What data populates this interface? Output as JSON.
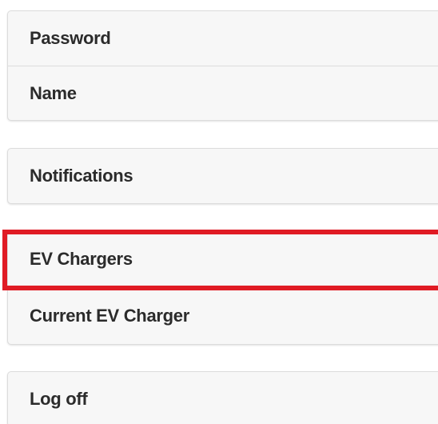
{
  "menu": {
    "account_group": [
      {
        "label": "Password"
      },
      {
        "label": "Name"
      }
    ],
    "notifications_group": [
      {
        "label": "Notifications"
      }
    ],
    "ev_group": [
      {
        "label": "EV Chargers",
        "highlighted": true
      },
      {
        "label": "Current EV Charger"
      }
    ],
    "session_group": [
      {
        "label": "Log off"
      }
    ]
  },
  "colors": {
    "highlight": "#e01b24",
    "item_background": "#f7f7f7",
    "text": "#2b2b2b"
  }
}
